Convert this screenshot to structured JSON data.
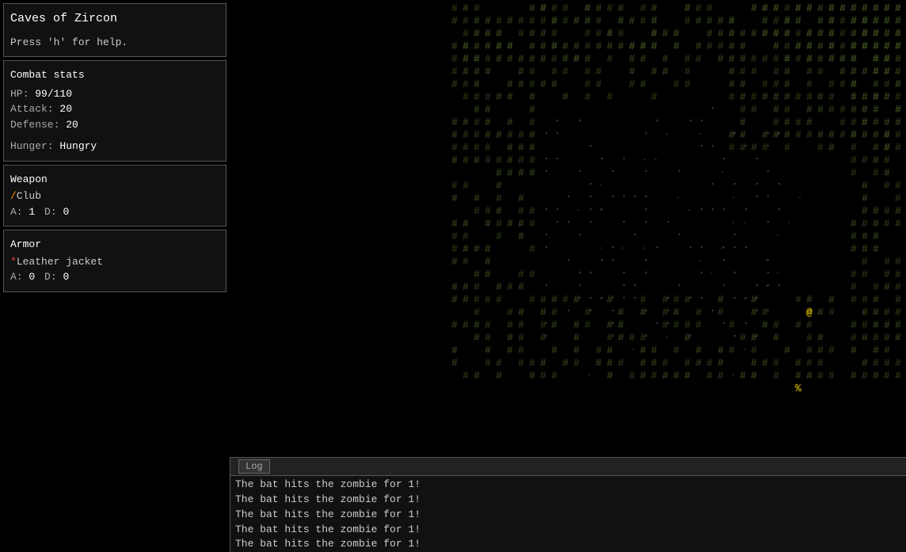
{
  "app": {
    "title": "Caves of Zircon"
  },
  "sidebar": {
    "title_panel": {
      "title": "Caves of Zircon",
      "help_text": "Press 'h' for help."
    },
    "combat_panel": {
      "title": "Combat stats",
      "hp_label": "HP:",
      "hp_value": "99/110",
      "attack_label": "Attack:",
      "attack_value": "20",
      "defense_label": "Defense:",
      "defense_value": "20",
      "hunger_label": "Hunger:",
      "hunger_value": "Hungry"
    },
    "weapon_panel": {
      "title": "Weapon",
      "name": "Club",
      "icon": "/",
      "attack_label": "A:",
      "attack_value": "1",
      "defense_label": "D:",
      "defense_value": "0"
    },
    "armor_panel": {
      "title": "Armor",
      "name": "Leather jacket",
      "icon": "*",
      "attack_label": "A:",
      "attack_value": "0",
      "defense_label": "D:",
      "defense_value": "0"
    }
  },
  "log": {
    "tab_label": "Log",
    "messages": [
      "The bat hits the zombie for 1!",
      "The bat hits the zombie for 1!",
      "The bat hits the zombie for 1!",
      "The bat hits the zombie for 1!",
      "The bat hits the zombie for 1!"
    ]
  },
  "map": {
    "player_symbol": "@",
    "enemy_symbols": [
      "%",
      "%",
      "%"
    ],
    "colors": {
      "background": "#000000",
      "wall": "#556b2f",
      "floor": "#3a3a3a",
      "player": "#ffff00",
      "enemy": "#ffff00",
      "bat": "#ffff00"
    }
  }
}
